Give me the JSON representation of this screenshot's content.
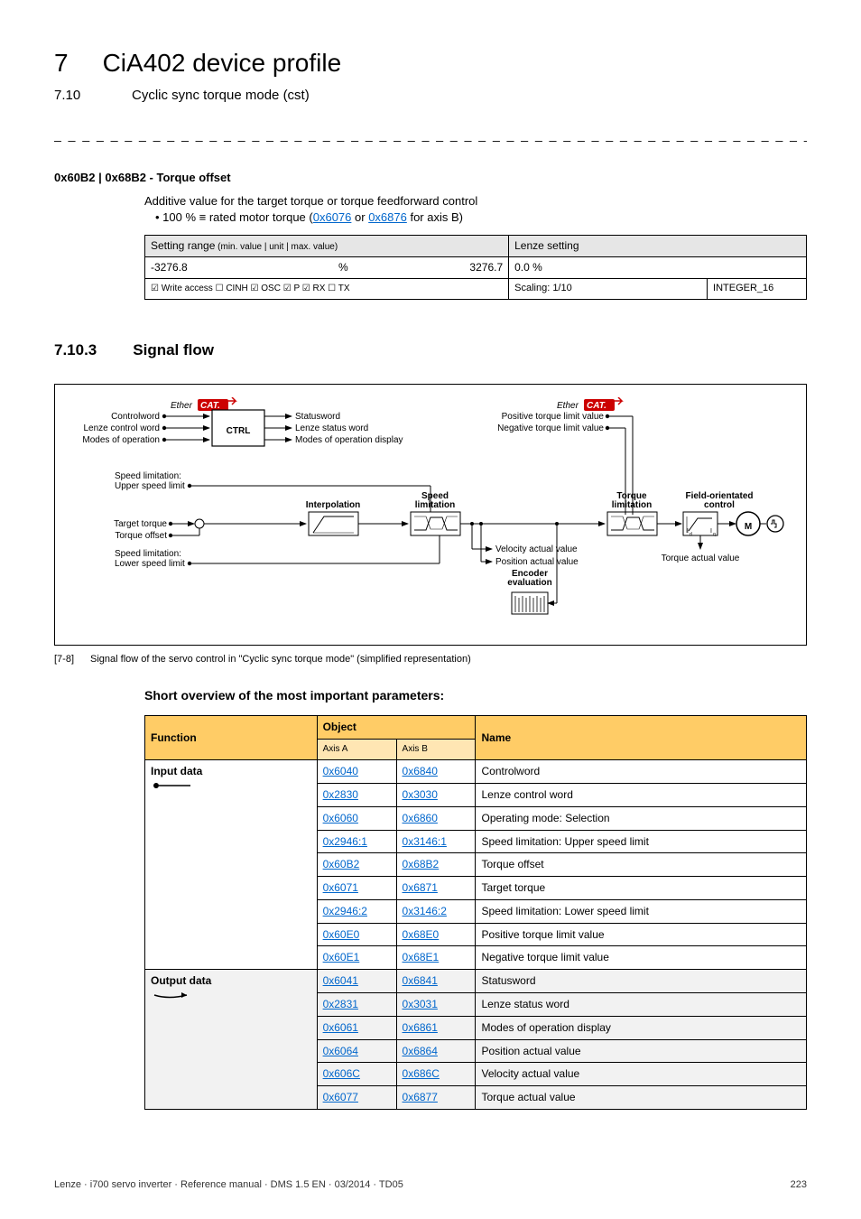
{
  "header": {
    "chapnum": "7",
    "chaptitle": "CiA402 device profile",
    "subnum": "7.10",
    "subtitle": "Cyclic sync torque mode (cst)"
  },
  "param": {
    "title": "0x60B2 | 0x68B2 - Torque offset",
    "desc_line1": "Additive value for the target torque or torque feedforward control",
    "desc_bullet_pre": "• 100 % ≡ rated motor torque (",
    "desc_link1": "0x6076",
    "desc_mid": " or ",
    "desc_link2": "0x6876",
    "desc_bullet_post": " for axis B)"
  },
  "settings": {
    "h1": "Setting range",
    "h1_small": " (min. value | unit | max. value)",
    "h2": "Lenze setting",
    "min": "-3276.8",
    "unit": "%",
    "max": "3276.7",
    "default": "0.0 %",
    "access": "☑ Write access   ☐ CINH   ☑ OSC   ☑ P   ☑ RX   ☐ TX",
    "scaling": "Scaling: 1/10",
    "dtype": "INTEGER_16"
  },
  "sec2": {
    "num": "7.10.3",
    "title": "Signal flow"
  },
  "diagram": {
    "ethercat1": "EtherCAT.",
    "ethercat2": "EtherCAT.",
    "controlword": "Controlword",
    "lenze_ctrl_word": "Lenze control word",
    "modes_op": "Modes of operation",
    "ctrl": "CTRL",
    "statusword": "Statusword",
    "lenze_status": "Lenze status word",
    "modes_disp": "Modes of operation display",
    "pos_tq_lim": "Positive torque limit value",
    "neg_tq_lim": "Negative torque limit value",
    "speed_lim_upper_t": "Speed limitation:",
    "speed_lim_upper": "Upper speed limit",
    "target_tq": "Target torque",
    "tq_offset": "Torque offset",
    "speed_lim_lower_t": "Speed limitation:",
    "speed_lim_lower": "Lower speed limit",
    "interp": "Interpolation",
    "speed_lim_box_t1": "Speed",
    "speed_lim_box_t2": "limitation",
    "vel_actual": "Velocity actual value",
    "pos_actual": "Position actual value",
    "enc_t1": "Encoder",
    "enc_t2": "evaluation",
    "tq_lim_t1": "Torque",
    "tq_lim_t2": "limitation",
    "foc_t1": "Field-orientated",
    "foc_t2": "control",
    "tq_actual": "Torque actual value",
    "motor": "M"
  },
  "caption": {
    "num": "[7-8]",
    "text": "Signal flow of the servo control in \"Cyclic sync torque mode\" (simplified representation)"
  },
  "short": "Short overview of the most important parameters:",
  "ov": {
    "h_func": "Function",
    "h_obj": "Object",
    "h_name": "Name",
    "axisA": "Axis A",
    "axisB": "Axis B",
    "input": "Input data",
    "output": "Output data",
    "rows_in": [
      {
        "a": "0x6040",
        "b": "0x6840",
        "n": "Controlword"
      },
      {
        "a": "0x2830",
        "b": "0x3030",
        "n": "Lenze control word"
      },
      {
        "a": "0x6060",
        "b": "0x6860",
        "n": "Operating mode: Selection"
      },
      {
        "a": "0x2946:1",
        "b": "0x3146:1",
        "n": "Speed limitation: Upper speed limit"
      },
      {
        "a": "0x60B2",
        "b": "0x68B2",
        "n": "Torque offset"
      },
      {
        "a": "0x6071",
        "b": "0x6871",
        "n": "Target torque"
      },
      {
        "a": "0x2946:2",
        "b": "0x3146:2",
        "n": "Speed limitation: Lower speed limit"
      },
      {
        "a": "0x60E0",
        "b": "0x68E0",
        "n": "Positive torque limit value"
      },
      {
        "a": "0x60E1",
        "b": "0x68E1",
        "n": "Negative torque limit value"
      }
    ],
    "rows_out": [
      {
        "a": "0x6041",
        "b": "0x6841",
        "n": "Statusword"
      },
      {
        "a": "0x2831",
        "b": "0x3031",
        "n": "Lenze status word"
      },
      {
        "a": "0x6061",
        "b": "0x6861",
        "n": "Modes of operation display"
      },
      {
        "a": "0x6064",
        "b": "0x6864",
        "n": "Position actual value"
      },
      {
        "a": "0x606C",
        "b": "0x686C",
        "n": "Velocity actual value"
      },
      {
        "a": "0x6077",
        "b": "0x6877",
        "n": "Torque actual value"
      }
    ]
  },
  "footer": {
    "left": "Lenze · i700 servo inverter · Reference manual · DMS 1.5 EN · 03/2014 · TD05",
    "right": "223"
  }
}
